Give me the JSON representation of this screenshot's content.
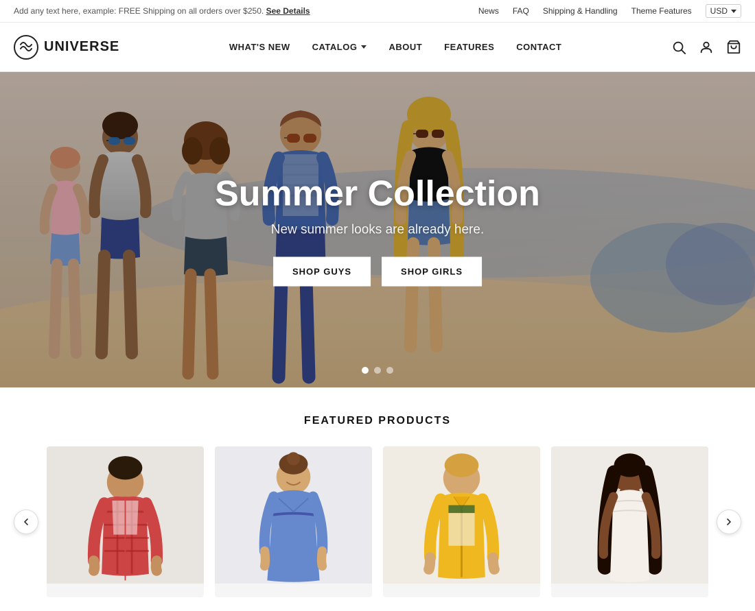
{
  "announcement": {
    "text": "Add any text here, example: FREE Shipping on all orders over $250.",
    "link_text": "See Details",
    "links": [
      "News",
      "FAQ",
      "Shipping & Handling",
      "Theme Features"
    ],
    "currency": "USD"
  },
  "nav": {
    "brand": "UNIVERSE",
    "links": [
      {
        "label": "WHAT'S NEW",
        "has_dropdown": false
      },
      {
        "label": "CATALOG",
        "has_dropdown": true
      },
      {
        "label": "ABOUT",
        "has_dropdown": false
      },
      {
        "label": "FEATURES",
        "has_dropdown": false
      },
      {
        "label": "CONTACT",
        "has_dropdown": false
      }
    ]
  },
  "hero": {
    "title": "Summer Collection",
    "subtitle": "New summer looks are already here.",
    "btn1": "SHOP GUYS",
    "btn2": "SHOP GIRLS",
    "dots": [
      true,
      false,
      false
    ]
  },
  "featured": {
    "title": "FEATURED PRODUCTS",
    "products": [
      {
        "id": 1,
        "bg": "#e8e4e0"
      },
      {
        "id": 2,
        "bg": "#e8e8ec"
      },
      {
        "id": 3,
        "bg": "#f0ece4"
      },
      {
        "id": 4,
        "bg": "#eeeae6"
      }
    ]
  },
  "icons": {
    "search": "⌕",
    "user": "👤",
    "bag": "🛍",
    "chevron_left": "‹",
    "chevron_right": "›"
  }
}
